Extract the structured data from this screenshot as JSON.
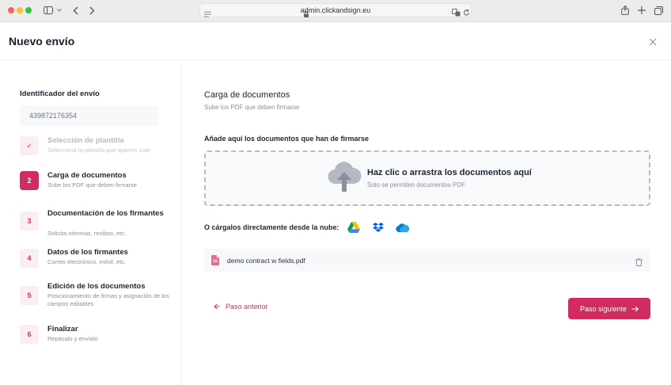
{
  "browser": {
    "url": "admin.clickandsign.eu"
  },
  "header": {
    "title": "Nuevo envío"
  },
  "sidebar": {
    "id_label": "Identificador del envío",
    "id_value": "439872176354",
    "steps": [
      {
        "num": "✓",
        "title": "Selección de plantilla",
        "subtitle": "Selecciona la plantilla que quieres usar",
        "state": "done"
      },
      {
        "num": "2",
        "title": "Carga de documentos",
        "subtitle": "Sube los PDF que deben firmarse",
        "state": "active"
      },
      {
        "num": "3",
        "title": "Documentación de los firmantes",
        "subtitle": "Solicita nóminas, recibos, etc.",
        "state": "pending"
      },
      {
        "num": "4",
        "title": "Datos de los firmantes",
        "subtitle": "Correo electrónico, móvil, etc.",
        "state": "pending"
      },
      {
        "num": "5",
        "title": "Edición de los documentos",
        "subtitle": "Posicionamiento de firmas y asignación de los campos editables",
        "state": "pending"
      },
      {
        "num": "6",
        "title": "Finalizar",
        "subtitle": "Repásalo y envíalo",
        "state": "pending"
      }
    ]
  },
  "main": {
    "title": "Carga de documentos",
    "subtitle": "Sube los PDF que deben firmarse",
    "add_label": "Añade aquí los documentos que han de firmarse",
    "dropzone": {
      "title": "Haz clic o arrastra los documentos aquí",
      "subtitle": "Solo se permiten documentos PDF"
    },
    "cloud_label": "O cárgalos directamente desde la nube:",
    "cloud_services": [
      "google-drive-icon",
      "dropbox-icon",
      "onedrive-icon"
    ],
    "files": [
      {
        "name": "demo contract w fields.pdf"
      }
    ],
    "prev_label": "Paso anterior",
    "next_label": "Paso siguiente"
  },
  "colors": {
    "accent": "#d12c5f",
    "accent_light": "#fbeef3"
  }
}
